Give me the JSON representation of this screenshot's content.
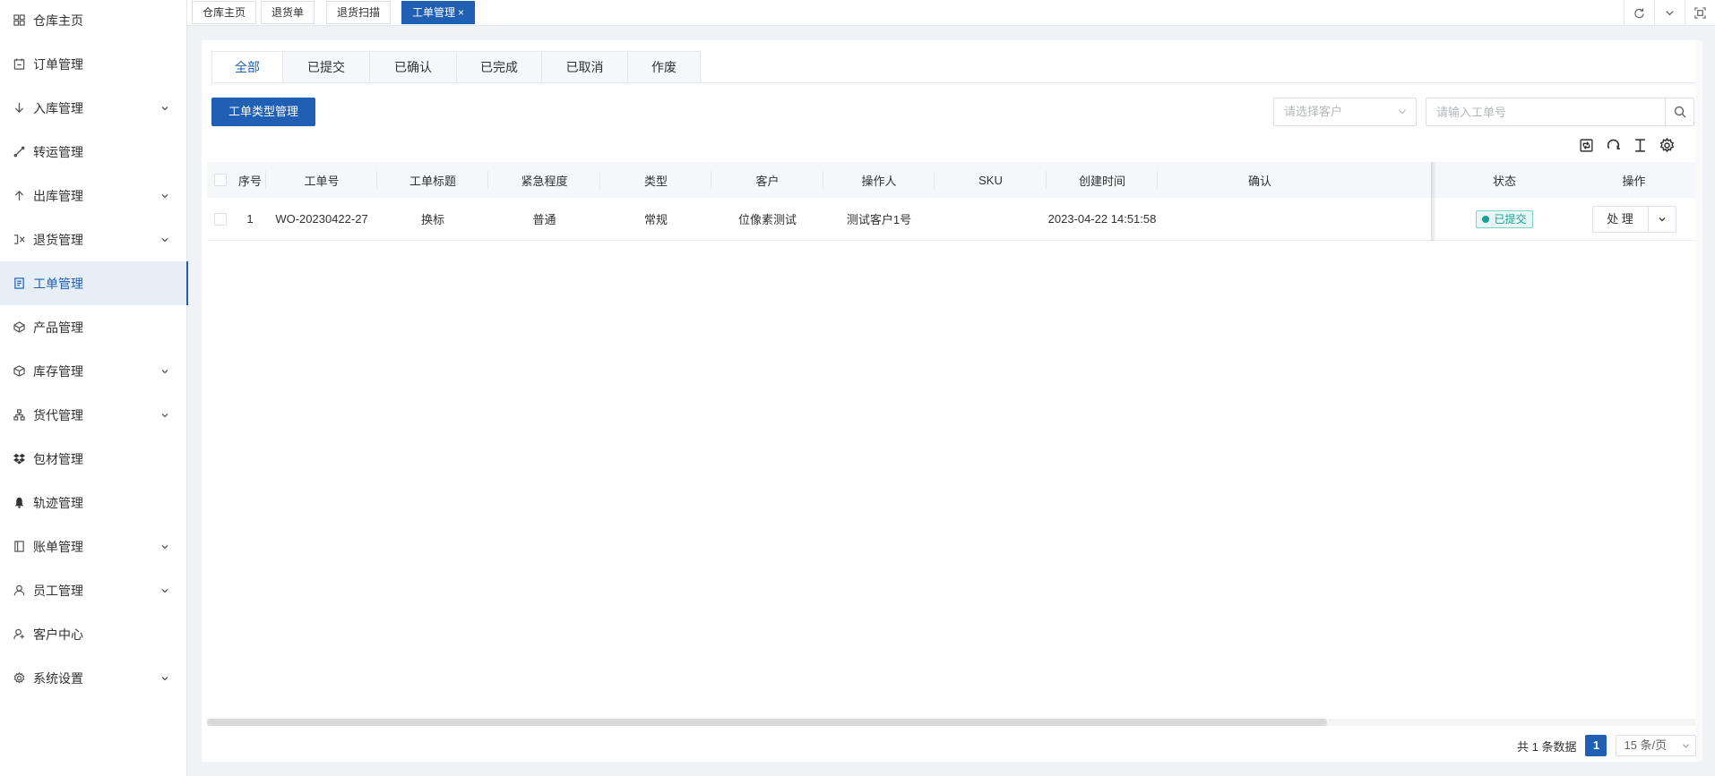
{
  "sidebar": {
    "items": [
      {
        "label": "仓库主页",
        "icon": "dashboard-icon",
        "expandable": false,
        "active": false
      },
      {
        "label": "订单管理",
        "icon": "order-icon",
        "expandable": false,
        "active": false
      },
      {
        "label": "入库管理",
        "icon": "arrow-down-icon",
        "expandable": true,
        "active": false
      },
      {
        "label": "转运管理",
        "icon": "transfer-icon",
        "expandable": false,
        "active": false
      },
      {
        "label": "出库管理",
        "icon": "arrow-up-icon",
        "expandable": true,
        "active": false
      },
      {
        "label": "退货管理",
        "icon": "return-icon",
        "expandable": true,
        "active": false
      },
      {
        "label": "工单管理",
        "icon": "ticket-icon",
        "expandable": false,
        "active": true
      },
      {
        "label": "产品管理",
        "icon": "product-icon",
        "expandable": false,
        "active": false
      },
      {
        "label": "库存管理",
        "icon": "cube-icon",
        "expandable": true,
        "active": false
      },
      {
        "label": "货代管理",
        "icon": "hierarchy-icon",
        "expandable": true,
        "active": false
      },
      {
        "label": "包材管理",
        "icon": "dropbox-icon",
        "expandable": false,
        "active": false
      },
      {
        "label": "轨迹管理",
        "icon": "bell-icon",
        "expandable": false,
        "active": false
      },
      {
        "label": "账单管理",
        "icon": "bill-icon",
        "expandable": true,
        "active": false
      },
      {
        "label": "员工管理",
        "icon": "user-icon",
        "expandable": true,
        "active": false
      },
      {
        "label": "客户中心",
        "icon": "customer-icon",
        "expandable": false,
        "active": false
      },
      {
        "label": "系统设置",
        "icon": "gear-icon",
        "expandable": true,
        "active": false
      }
    ]
  },
  "page_tabs": [
    {
      "label": "仓库主页",
      "active": false
    },
    {
      "label": "退货单",
      "active": false
    },
    {
      "label": "退货扫描",
      "active": false
    },
    {
      "label": "工单管理",
      "active": true,
      "close": "×"
    }
  ],
  "status_tabs": [
    "全部",
    "已提交",
    "已确认",
    "已完成",
    "已取消",
    "作废"
  ],
  "toolbar": {
    "type_manage_label": "工单类型管理",
    "customer_placeholder": "请选择客户",
    "search_placeholder": "请输入工单号"
  },
  "table": {
    "headers": {
      "index": "序号",
      "order_no": "工单号",
      "title": "工单标题",
      "urgency": "紧急程度",
      "type": "类型",
      "customer": "客户",
      "operator": "操作人",
      "sku": "SKU",
      "created": "创建时间",
      "confirm": "确认",
      "status": "状态",
      "action": "操作"
    },
    "rows": [
      {
        "index": "1",
        "order_no": "WO-20230422-27",
        "title": "换标",
        "urgency": "普通",
        "type": "常规",
        "customer": "位像素测试",
        "operator": "测试客户1号",
        "sku": "",
        "created": "2023-04-22 14:51:58",
        "status": "已提交",
        "action": "处 理"
      }
    ]
  },
  "pagination": {
    "total_text": "共 1 条数据",
    "current_page": "1",
    "page_size": "15 条/页"
  },
  "colors": {
    "primary": "#1f5fb4",
    "status_submitted": "#16a394"
  }
}
